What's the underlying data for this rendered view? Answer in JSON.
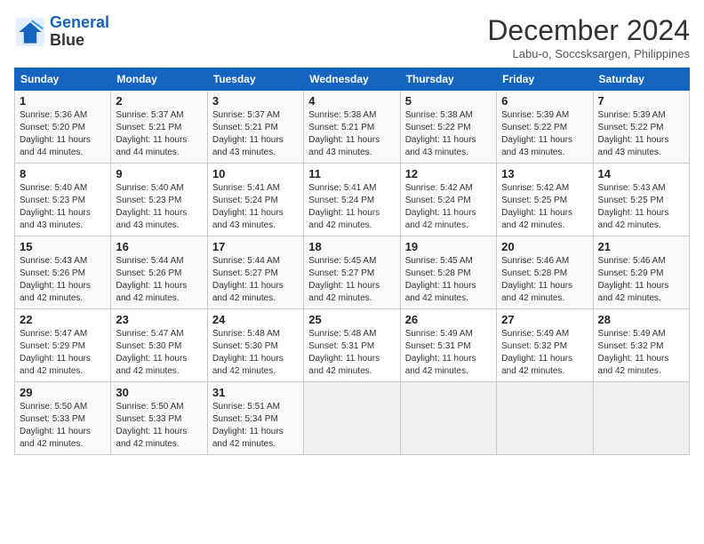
{
  "logo": {
    "line1": "General",
    "line2": "Blue"
  },
  "calendar": {
    "title": "December 2024",
    "subtitle": "Labu-o, Soccsksargen, Philippines",
    "days_of_week": [
      "Sunday",
      "Monday",
      "Tuesday",
      "Wednesday",
      "Thursday",
      "Friday",
      "Saturday"
    ],
    "weeks": [
      [
        null,
        null,
        null,
        null,
        null,
        null,
        null
      ]
    ]
  },
  "cells": [
    {
      "day": 1,
      "sunrise": "5:36 AM",
      "sunset": "5:20 PM",
      "daylight": "11 hours and 44 minutes."
    },
    {
      "day": 2,
      "sunrise": "5:37 AM",
      "sunset": "5:21 PM",
      "daylight": "11 hours and 44 minutes."
    },
    {
      "day": 3,
      "sunrise": "5:37 AM",
      "sunset": "5:21 PM",
      "daylight": "11 hours and 43 minutes."
    },
    {
      "day": 4,
      "sunrise": "5:38 AM",
      "sunset": "5:21 PM",
      "daylight": "11 hours and 43 minutes."
    },
    {
      "day": 5,
      "sunrise": "5:38 AM",
      "sunset": "5:22 PM",
      "daylight": "11 hours and 43 minutes."
    },
    {
      "day": 6,
      "sunrise": "5:39 AM",
      "sunset": "5:22 PM",
      "daylight": "11 hours and 43 minutes."
    },
    {
      "day": 7,
      "sunrise": "5:39 AM",
      "sunset": "5:22 PM",
      "daylight": "11 hours and 43 minutes."
    },
    {
      "day": 8,
      "sunrise": "5:40 AM",
      "sunset": "5:23 PM",
      "daylight": "11 hours and 43 minutes."
    },
    {
      "day": 9,
      "sunrise": "5:40 AM",
      "sunset": "5:23 PM",
      "daylight": "11 hours and 43 minutes."
    },
    {
      "day": 10,
      "sunrise": "5:41 AM",
      "sunset": "5:24 PM",
      "daylight": "11 hours and 43 minutes."
    },
    {
      "day": 11,
      "sunrise": "5:41 AM",
      "sunset": "5:24 PM",
      "daylight": "11 hours and 42 minutes."
    },
    {
      "day": 12,
      "sunrise": "5:42 AM",
      "sunset": "5:24 PM",
      "daylight": "11 hours and 42 minutes."
    },
    {
      "day": 13,
      "sunrise": "5:42 AM",
      "sunset": "5:25 PM",
      "daylight": "11 hours and 42 minutes."
    },
    {
      "day": 14,
      "sunrise": "5:43 AM",
      "sunset": "5:25 PM",
      "daylight": "11 hours and 42 minutes."
    },
    {
      "day": 15,
      "sunrise": "5:43 AM",
      "sunset": "5:26 PM",
      "daylight": "11 hours and 42 minutes."
    },
    {
      "day": 16,
      "sunrise": "5:44 AM",
      "sunset": "5:26 PM",
      "daylight": "11 hours and 42 minutes."
    },
    {
      "day": 17,
      "sunrise": "5:44 AM",
      "sunset": "5:27 PM",
      "daylight": "11 hours and 42 minutes."
    },
    {
      "day": 18,
      "sunrise": "5:45 AM",
      "sunset": "5:27 PM",
      "daylight": "11 hours and 42 minutes."
    },
    {
      "day": 19,
      "sunrise": "5:45 AM",
      "sunset": "5:28 PM",
      "daylight": "11 hours and 42 minutes."
    },
    {
      "day": 20,
      "sunrise": "5:46 AM",
      "sunset": "5:28 PM",
      "daylight": "11 hours and 42 minutes."
    },
    {
      "day": 21,
      "sunrise": "5:46 AM",
      "sunset": "5:29 PM",
      "daylight": "11 hours and 42 minutes."
    },
    {
      "day": 22,
      "sunrise": "5:47 AM",
      "sunset": "5:29 PM",
      "daylight": "11 hours and 42 minutes."
    },
    {
      "day": 23,
      "sunrise": "5:47 AM",
      "sunset": "5:30 PM",
      "daylight": "11 hours and 42 minutes."
    },
    {
      "day": 24,
      "sunrise": "5:48 AM",
      "sunset": "5:30 PM",
      "daylight": "11 hours and 42 minutes."
    },
    {
      "day": 25,
      "sunrise": "5:48 AM",
      "sunset": "5:31 PM",
      "daylight": "11 hours and 42 minutes."
    },
    {
      "day": 26,
      "sunrise": "5:49 AM",
      "sunset": "5:31 PM",
      "daylight": "11 hours and 42 minutes."
    },
    {
      "day": 27,
      "sunrise": "5:49 AM",
      "sunset": "5:32 PM",
      "daylight": "11 hours and 42 minutes."
    },
    {
      "day": 28,
      "sunrise": "5:49 AM",
      "sunset": "5:32 PM",
      "daylight": "11 hours and 42 minutes."
    },
    {
      "day": 29,
      "sunrise": "5:50 AM",
      "sunset": "5:33 PM",
      "daylight": "11 hours and 42 minutes."
    },
    {
      "day": 30,
      "sunrise": "5:50 AM",
      "sunset": "5:33 PM",
      "daylight": "11 hours and 42 minutes."
    },
    {
      "day": 31,
      "sunrise": "5:51 AM",
      "sunset": "5:34 PM",
      "daylight": "11 hours and 42 minutes."
    }
  ]
}
